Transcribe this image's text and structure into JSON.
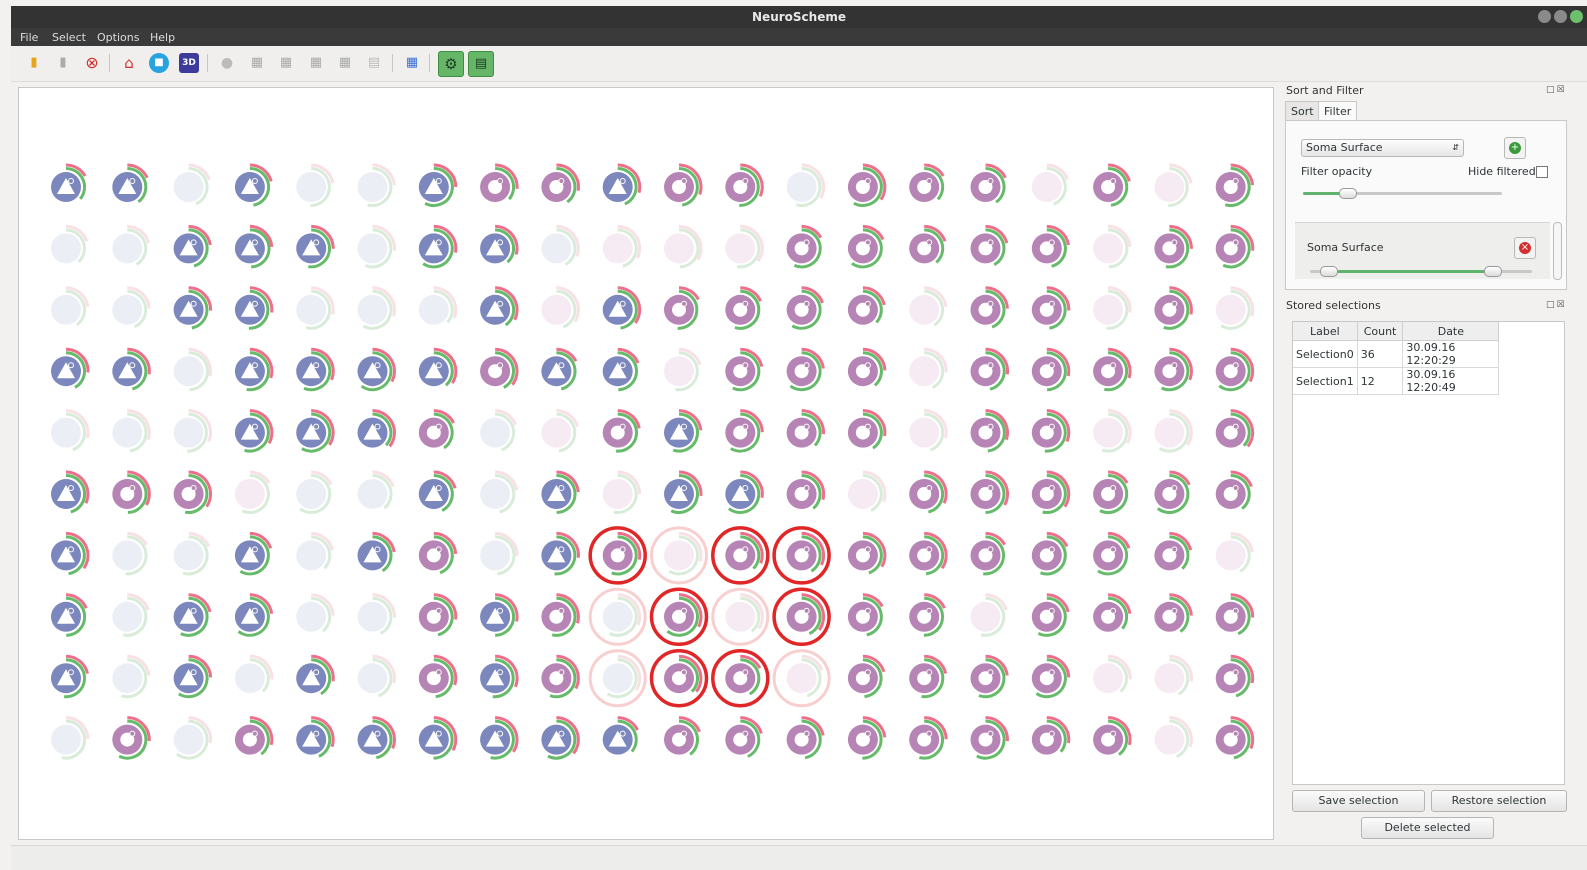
{
  "window": {
    "title": "NeuroScheme"
  },
  "menu": [
    "File",
    "Select",
    "Options",
    "Help"
  ],
  "toolbar": {
    "icons": [
      "open-folder-icon",
      "folder-icon",
      "close-circle-icon",
      "home-icon",
      "2d-view-icon",
      "3d-view-icon",
      "person-icon",
      "scene-icon",
      "scene-2-icon",
      "scene-3-icon",
      "scene-4-icon",
      "scene-5-icon",
      "layout-icon",
      "settings-gear-icon",
      "panel-toggle-icon"
    ]
  },
  "sort_filter": {
    "title": "Sort and Filter",
    "tabs": [
      "Sort",
      "Filter"
    ],
    "active_tab": "Filter",
    "property_combo": "Soma Surface",
    "filter_opacity_label": "Filter opacity",
    "hide_filtered_label": "Hide filtered",
    "hide_filtered_checked": false,
    "filter_opacity_value": 0.22,
    "filter_item": {
      "label": "Soma Surface",
      "range_low": 0.08,
      "range_high": 0.82
    }
  },
  "stored_selections": {
    "title": "Stored selections",
    "columns": [
      "Label",
      "Count",
      "Date"
    ],
    "rows": [
      {
        "label": "Selection0",
        "count": "36",
        "date": "30.09.16 12:20:29"
      },
      {
        "label": "Selection1",
        "count": "12",
        "date": "30.09.16 12:20:49"
      }
    ],
    "save_label": "Save selection",
    "restore_label": "Restore selection",
    "delete_label": "Delete selected"
  },
  "scene": {
    "legend": "T = pyramidal (blue triangle), O = interneuron (purple ring); lowercase = filtered-out (faded); * = selected (red outline)",
    "rows": [
      [
        "T",
        "T",
        "t",
        "T",
        "t",
        "t",
        "T",
        "O",
        "O",
        "T",
        "O",
        "O",
        "t",
        "O",
        "O",
        "O",
        "o",
        "O",
        "o",
        "O"
      ],
      [
        "t",
        "t",
        "T",
        "T",
        "T",
        "t",
        "T",
        "T",
        "t",
        "o",
        "o",
        "o",
        "O",
        "O",
        "O",
        "O",
        "O",
        "o",
        "O",
        "O"
      ],
      [
        "t",
        "t",
        "T",
        "T",
        "t",
        "t",
        "t",
        "T",
        "o",
        "T",
        "O",
        "O",
        "O",
        "O",
        "o",
        "O",
        "O",
        "o",
        "O",
        "o"
      ],
      [
        "T",
        "T",
        "t",
        "T",
        "T",
        "T",
        "T",
        "O",
        "T",
        "T",
        "o",
        "O",
        "O",
        "O",
        "o",
        "O",
        "O",
        "O",
        "O",
        "O"
      ],
      [
        "t",
        "t",
        "t",
        "T",
        "T",
        "T",
        "O",
        "t",
        "o",
        "O",
        "T",
        "O",
        "O",
        "O",
        "o",
        "O",
        "O",
        "o",
        "o",
        "O"
      ],
      [
        "T",
        "O",
        "O",
        "o",
        "t",
        "t",
        "T",
        "t",
        "T",
        "o",
        "T",
        "T",
        "O",
        "o",
        "O",
        "O",
        "O",
        "O",
        "O",
        "O"
      ],
      [
        "T",
        "t",
        "t",
        "T",
        "t",
        "T",
        "O",
        "t",
        "T",
        "O*",
        "o*",
        "O*",
        "O*",
        "O",
        "O",
        "O",
        "O",
        "O",
        "O",
        "o"
      ],
      [
        "T",
        "t",
        "T",
        "T",
        "t",
        "t",
        "O",
        "T",
        "O",
        "t*",
        "O*",
        "o*",
        "O*",
        "O",
        "O",
        "o",
        "O",
        "O",
        "O",
        "O"
      ],
      [
        "T",
        "t",
        "T",
        "t",
        "T",
        "t",
        "O",
        "T",
        "O",
        "t*",
        "O*",
        "O*",
        "o*",
        "O",
        "O",
        "O",
        "O",
        "o",
        "o",
        "O"
      ],
      [
        "t",
        "O",
        "t",
        "O",
        "T",
        "T",
        "T",
        "T",
        "T",
        "T",
        "O",
        "O",
        "O",
        "O",
        "O",
        "O",
        "O",
        "O",
        "o",
        "O"
      ]
    ]
  },
  "colors": {
    "pyramidal": "#7b87bd",
    "interneuron": "#b684b5",
    "faded_blue": "#eaedf6",
    "faded_purple": "#f6e8f2",
    "ring_green": "#66bb6a",
    "ring_pink": "#ef6f8a",
    "selection": "#e02626"
  }
}
